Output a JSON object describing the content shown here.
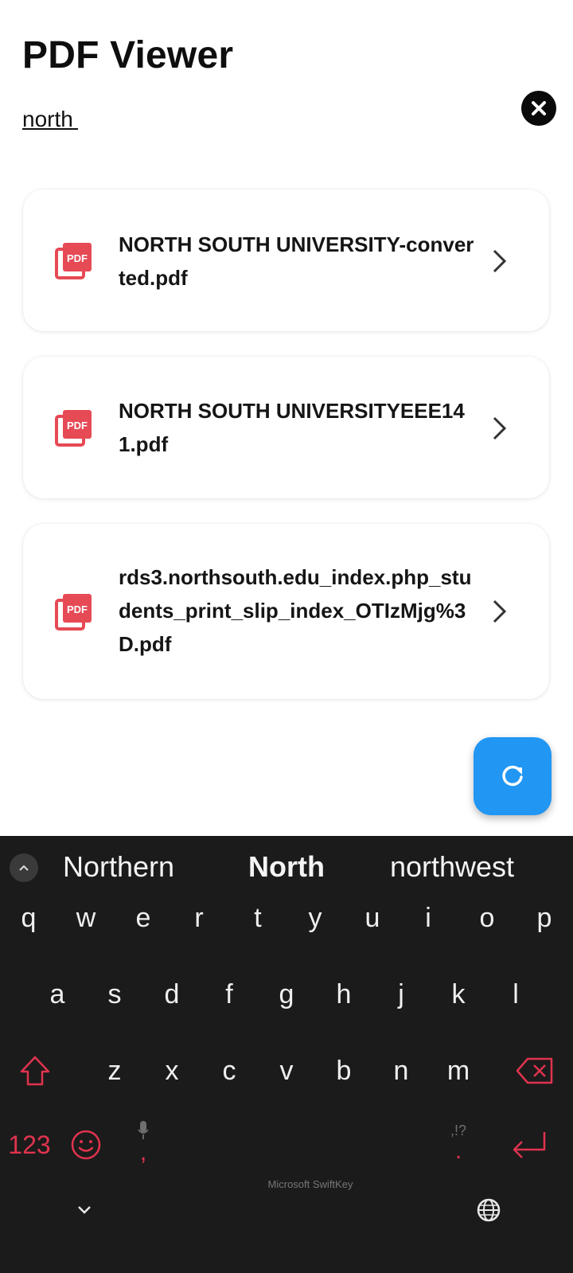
{
  "app": {
    "title": "PDF Viewer"
  },
  "search": {
    "value": "north"
  },
  "files": [
    {
      "name": "NORTH SOUTH UNIVERSITY-converted.pdf",
      "icon": "pdf-file-icon"
    },
    {
      "name": "NORTH SOUTH UNIVERSITYEEE141.pdf",
      "icon": "pdf-file-icon"
    },
    {
      "name": "rds3.northsouth.edu_index.php_students_print_slip_index_OTIzMjg%3D.pdf",
      "icon": "pdf-file-icon"
    }
  ],
  "fab": {
    "icon": "refresh-icon"
  },
  "keyboard": {
    "suggestions": [
      "Northern",
      "North",
      "northwest"
    ],
    "rows": [
      [
        "q",
        "w",
        "e",
        "r",
        "t",
        "y",
        "u",
        "i",
        "o",
        "p"
      ],
      [
        "a",
        "s",
        "d",
        "f",
        "g",
        "h",
        "j",
        "k",
        "l"
      ],
      [
        "z",
        "x",
        "c",
        "v",
        "b",
        "n",
        "m"
      ]
    ],
    "numbers_label": "123",
    "comma_label": ",",
    "period_label": ".",
    "punct_hint": ",!?",
    "brand": "Microsoft SwiftKey"
  },
  "colors": {
    "accent": "#2196f3",
    "pdf_red": "#e64a55",
    "keyboard_bg": "#1b1b1b",
    "keyboard_accent": "#e0334e"
  }
}
